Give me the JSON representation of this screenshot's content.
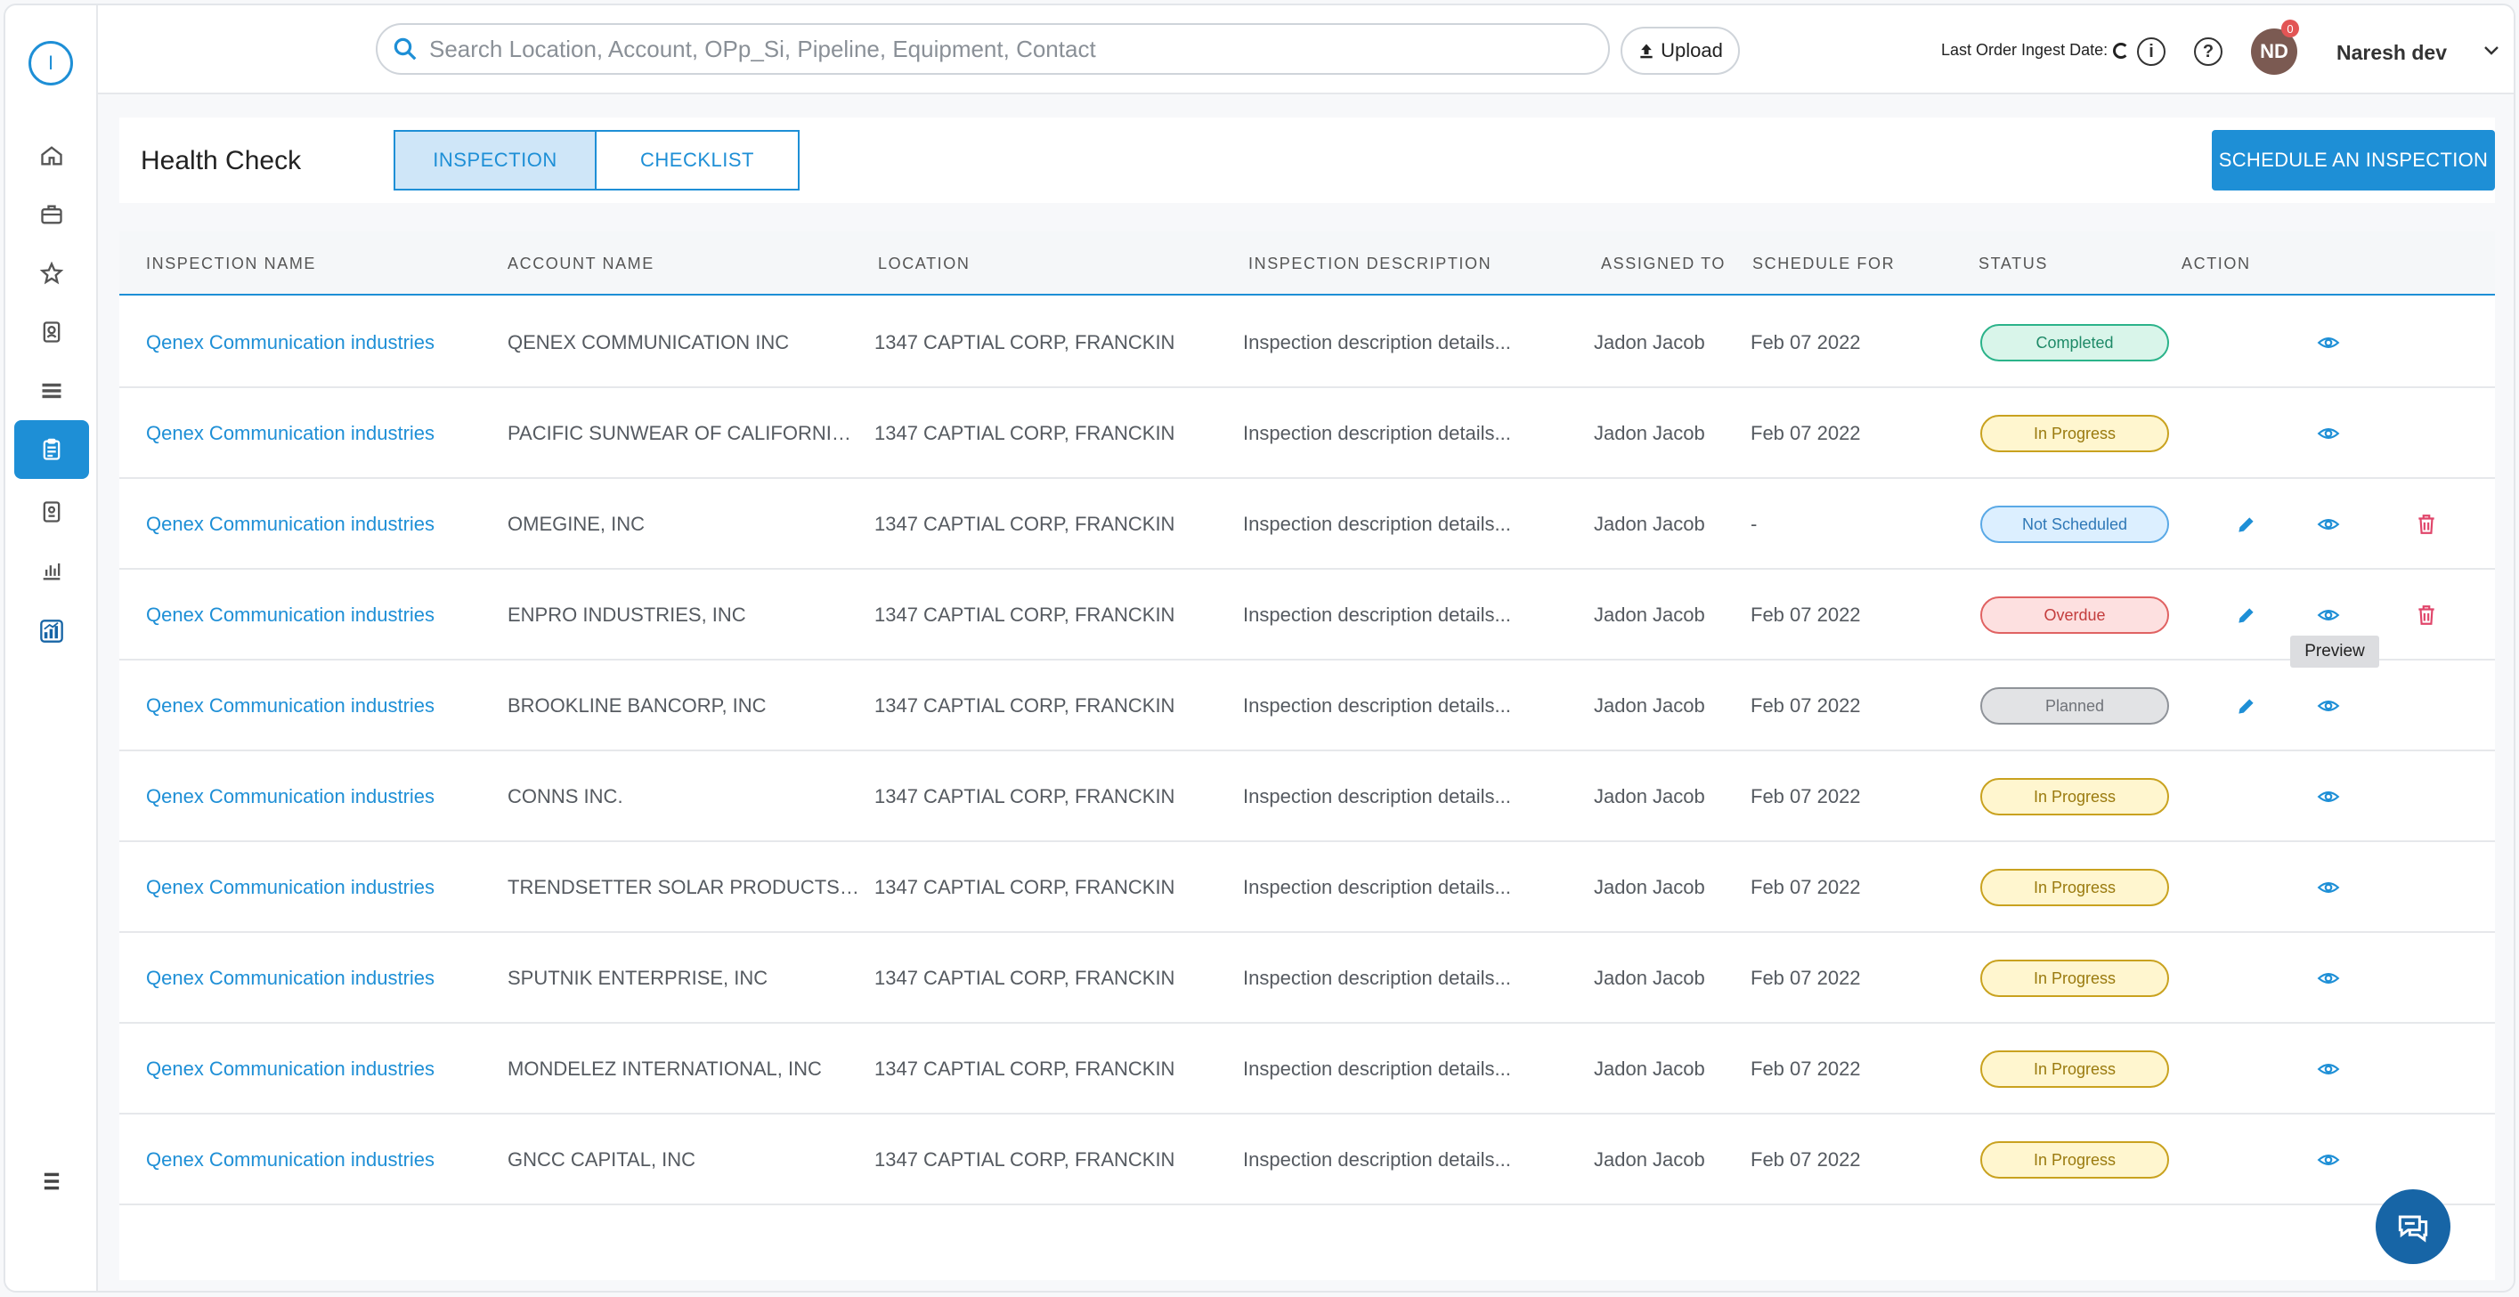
{
  "colors": {
    "accent": "#1e8fd6",
    "completed": "#2bb38a",
    "in_progress": "#c9a21f",
    "not_scheduled": "#5aa9e6",
    "overdue": "#e06262",
    "planned": "#8f9399"
  },
  "sidebar": {
    "logo_text": "I",
    "items": [
      {
        "name": "home-icon",
        "active": false
      },
      {
        "name": "briefcase-icon",
        "active": false
      },
      {
        "name": "star-icon",
        "active": false
      },
      {
        "name": "contact-card-icon",
        "active": false
      },
      {
        "name": "list-icon",
        "active": false
      },
      {
        "name": "clipboard-icon",
        "active": true
      },
      {
        "name": "badge-icon",
        "active": false
      },
      {
        "name": "bar-chart-icon",
        "active": false
      },
      {
        "name": "analytics-icon",
        "active": false
      }
    ],
    "menu_icon": "menu-icon"
  },
  "topbar": {
    "search_placeholder": "Search Location, Account, OPp_Si, Pipeline, Equipment, Contact",
    "upload_label": "Upload",
    "ingest_label": "Last Order Ingest Date:",
    "avatar_initials": "ND",
    "notification_count": "0",
    "user_name": "Naresh dev"
  },
  "header": {
    "title": "Health Check",
    "tabs": [
      {
        "label": "INSPECTION",
        "active": true
      },
      {
        "label": "CHECKLIST",
        "active": false
      }
    ],
    "schedule_button": "SCHEDULE AN INSPECTION"
  },
  "table": {
    "columns": [
      "INSPECTION NAME",
      "ACCOUNT NAME",
      "LOCATION",
      "INSPECTION DESCRIPTION",
      "ASSIGNED TO",
      "SCHEDULE FOR",
      "STATUS",
      "ACTION"
    ],
    "rows": [
      {
        "name": "Qenex Communication industries",
        "account": "QENEX COMMUNICATION INC",
        "location": "1347 CAPTIAL CORP, FRANCKIN",
        "description": "Inspection description details...",
        "assigned": "Jadon Jacob",
        "schedule": "Feb 07 2022",
        "status": "Completed",
        "status_kind": "completed",
        "edit": false,
        "delete": false
      },
      {
        "name": "Qenex Communication industries",
        "account": "PACIFIC SUNWEAR OF CALIFORNIA I...",
        "location": "1347 CAPTIAL CORP, FRANCKIN",
        "description": "Inspection description details...",
        "assigned": "Jadon Jacob",
        "schedule": "Feb 07 2022",
        "status": "In Progress",
        "status_kind": "progress",
        "edit": false,
        "delete": false
      },
      {
        "name": "Qenex Communication industries",
        "account": "OMEGINE, INC",
        "location": "1347 CAPTIAL CORP, FRANCKIN",
        "description": "Inspection description details...",
        "assigned": "Jadon Jacob",
        "schedule": "-",
        "status": "Not Scheduled",
        "status_kind": "notsched",
        "edit": true,
        "delete": true
      },
      {
        "name": "Qenex Communication industries",
        "account": "ENPRO INDUSTRIES, INC",
        "location": "1347 CAPTIAL CORP, FRANCKIN",
        "description": "Inspection description details...",
        "assigned": "Jadon Jacob",
        "schedule": "Feb 07 2022",
        "status": "Overdue",
        "status_kind": "overdue",
        "edit": true,
        "delete": true
      },
      {
        "name": "Qenex Communication industries",
        "account": "BROOKLINE BANCORP, INC",
        "location": "1347 CAPTIAL CORP, FRANCKIN",
        "description": "Inspection description details...",
        "assigned": "Jadon Jacob",
        "schedule": "Feb 07 2022",
        "status": "Planned",
        "status_kind": "planned",
        "edit": true,
        "delete": false
      },
      {
        "name": "Qenex Communication industries",
        "account": "CONNS INC.",
        "location": "1347 CAPTIAL CORP, FRANCKIN",
        "description": "Inspection description details...",
        "assigned": "Jadon Jacob",
        "schedule": "Feb 07 2022",
        "status": "In Progress",
        "status_kind": "progress",
        "edit": false,
        "delete": false
      },
      {
        "name": "Qenex Communication industries",
        "account": "TRENDSETTER SOLAR PRODUCTS, I...",
        "location": "1347 CAPTIAL CORP, FRANCKIN",
        "description": "Inspection description details...",
        "assigned": "Jadon Jacob",
        "schedule": "Feb 07 2022",
        "status": "In Progress",
        "status_kind": "progress",
        "edit": false,
        "delete": false
      },
      {
        "name": "Qenex Communication industries",
        "account": "SPUTNIK ENTERPRISE, INC",
        "location": "1347 CAPTIAL CORP, FRANCKIN",
        "description": "Inspection description details...",
        "assigned": "Jadon Jacob",
        "schedule": "Feb 07 2022",
        "status": "In Progress",
        "status_kind": "progress",
        "edit": false,
        "delete": false
      },
      {
        "name": "Qenex Communication industries",
        "account": "MONDELEZ INTERNATIONAL, INC",
        "location": "1347 CAPTIAL CORP, FRANCKIN",
        "description": "Inspection description details...",
        "assigned": "Jadon Jacob",
        "schedule": "Feb 07 2022",
        "status": "In Progress",
        "status_kind": "progress",
        "edit": false,
        "delete": false
      },
      {
        "name": "Qenex Communication industries",
        "account": "GNCC CAPITAL, INC",
        "location": "1347 CAPTIAL CORP, FRANCKIN",
        "description": "Inspection description details...",
        "assigned": "Jadon Jacob",
        "schedule": "Feb 07 2022",
        "status": "In Progress",
        "status_kind": "progress",
        "edit": false,
        "delete": false
      }
    ]
  },
  "tooltip": {
    "text": "Preview"
  }
}
